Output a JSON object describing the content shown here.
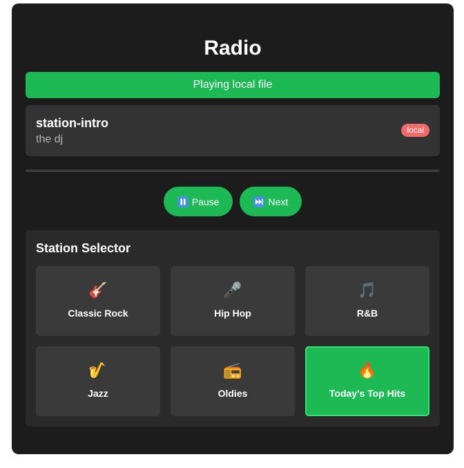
{
  "app": {
    "title": "Radio"
  },
  "status": {
    "message": "Playing local file",
    "color": "#1db954"
  },
  "now_playing": {
    "title": "station-intro",
    "artist": "the dj",
    "source_badge": "local",
    "badge_color": "#f26b6b"
  },
  "progress": {
    "fraction": 0
  },
  "controls": {
    "pause_label": "Pause",
    "pause_icon": "pause-icon",
    "next_label": "Next",
    "next_icon": "next-track-icon"
  },
  "selector": {
    "title": "Station Selector",
    "stations": [
      {
        "label": "Classic Rock",
        "emoji": "🎸",
        "icon": "guitar-icon",
        "active": false
      },
      {
        "label": "Hip Hop",
        "emoji": "🎤",
        "icon": "microphone-icon",
        "active": false
      },
      {
        "label": "R&B",
        "emoji": "🎵",
        "icon": "music-note-icon",
        "active": false
      },
      {
        "label": "Jazz",
        "emoji": "🎷",
        "icon": "saxophone-icon",
        "active": false
      },
      {
        "label": "Oldies",
        "emoji": "📻",
        "icon": "radio-icon",
        "active": false
      },
      {
        "label": "Today's Top Hits",
        "emoji": "🔥",
        "icon": "fire-icon",
        "active": true
      }
    ]
  },
  "colors": {
    "accent": "#1db954",
    "panel": "#1c1c1c",
    "card": "#3a3a3a"
  }
}
